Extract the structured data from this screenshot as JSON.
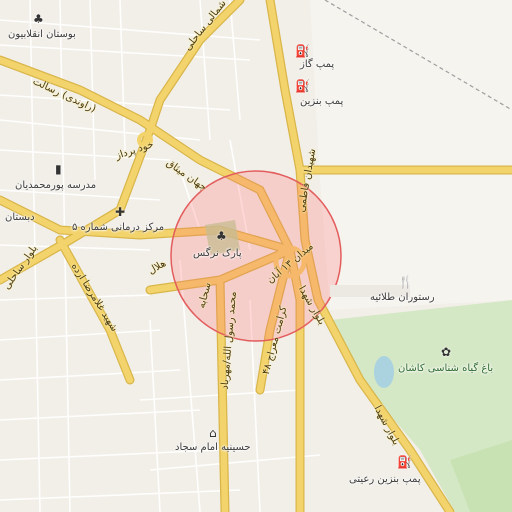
{
  "map": {
    "colors": {
      "background": "#f2efe9",
      "major_road": "#f3d36b",
      "road_casing": "#d9b64a",
      "highway": "#f7e199",
      "minor_road": "#ffffff",
      "green_area": "#d5e8c6",
      "park": "#b7d7a0",
      "water": "#aad3df",
      "rail": "#9e9e9e",
      "search_circle_fill": "#ff6b6b",
      "search_circle_stroke": "#e35d5d"
    },
    "search_area": {
      "shape": "circle",
      "fill_opacity": 0.25
    },
    "pois": [
      {
        "name": "بوستان انقلابیون",
        "icon": "tree-icon"
      },
      {
        "name": "پمپ گاز",
        "icon": "fuel-pump-icon"
      },
      {
        "name": "پمپ بنزین",
        "icon": "fuel-pump-icon"
      },
      {
        "name": "مدرسه پورمحمدیان",
        "icon": "school-icon"
      },
      {
        "name": "دبستان",
        "icon": "school-icon"
      },
      {
        "name": "مرکز درمانی شماره ۵",
        "icon": "hospital-cross-icon"
      },
      {
        "name": "پارک نرگس",
        "icon": "tree-icon"
      },
      {
        "name": "رستوران طلائیه",
        "icon": "restaurant-icon"
      },
      {
        "name": "باغ گیاه شناسی کاشان",
        "icon": "flower-icon"
      },
      {
        "name": "حسینیه امام سجاد",
        "icon": "mosque-icon"
      },
      {
        "name": "پمپ بنزین رعیتی",
        "icon": "fuel-pump-icon"
      }
    ],
    "streets": [
      "شمالی ساحلی",
      "(راوندی) رسالت",
      "خود پرداز",
      "جهان میثاق",
      "شهیدان فاطمی",
      "بلوار ساحلی",
      "شهید غلامرضا ارده",
      "هلال",
      "میدان ۱۳ آبان",
      "بلوار شهدا",
      "سحابه",
      "محمد رسول الله/مهرباد",
      "کرامت معراج ۴۸",
      "بلوار شهدا"
    ]
  }
}
